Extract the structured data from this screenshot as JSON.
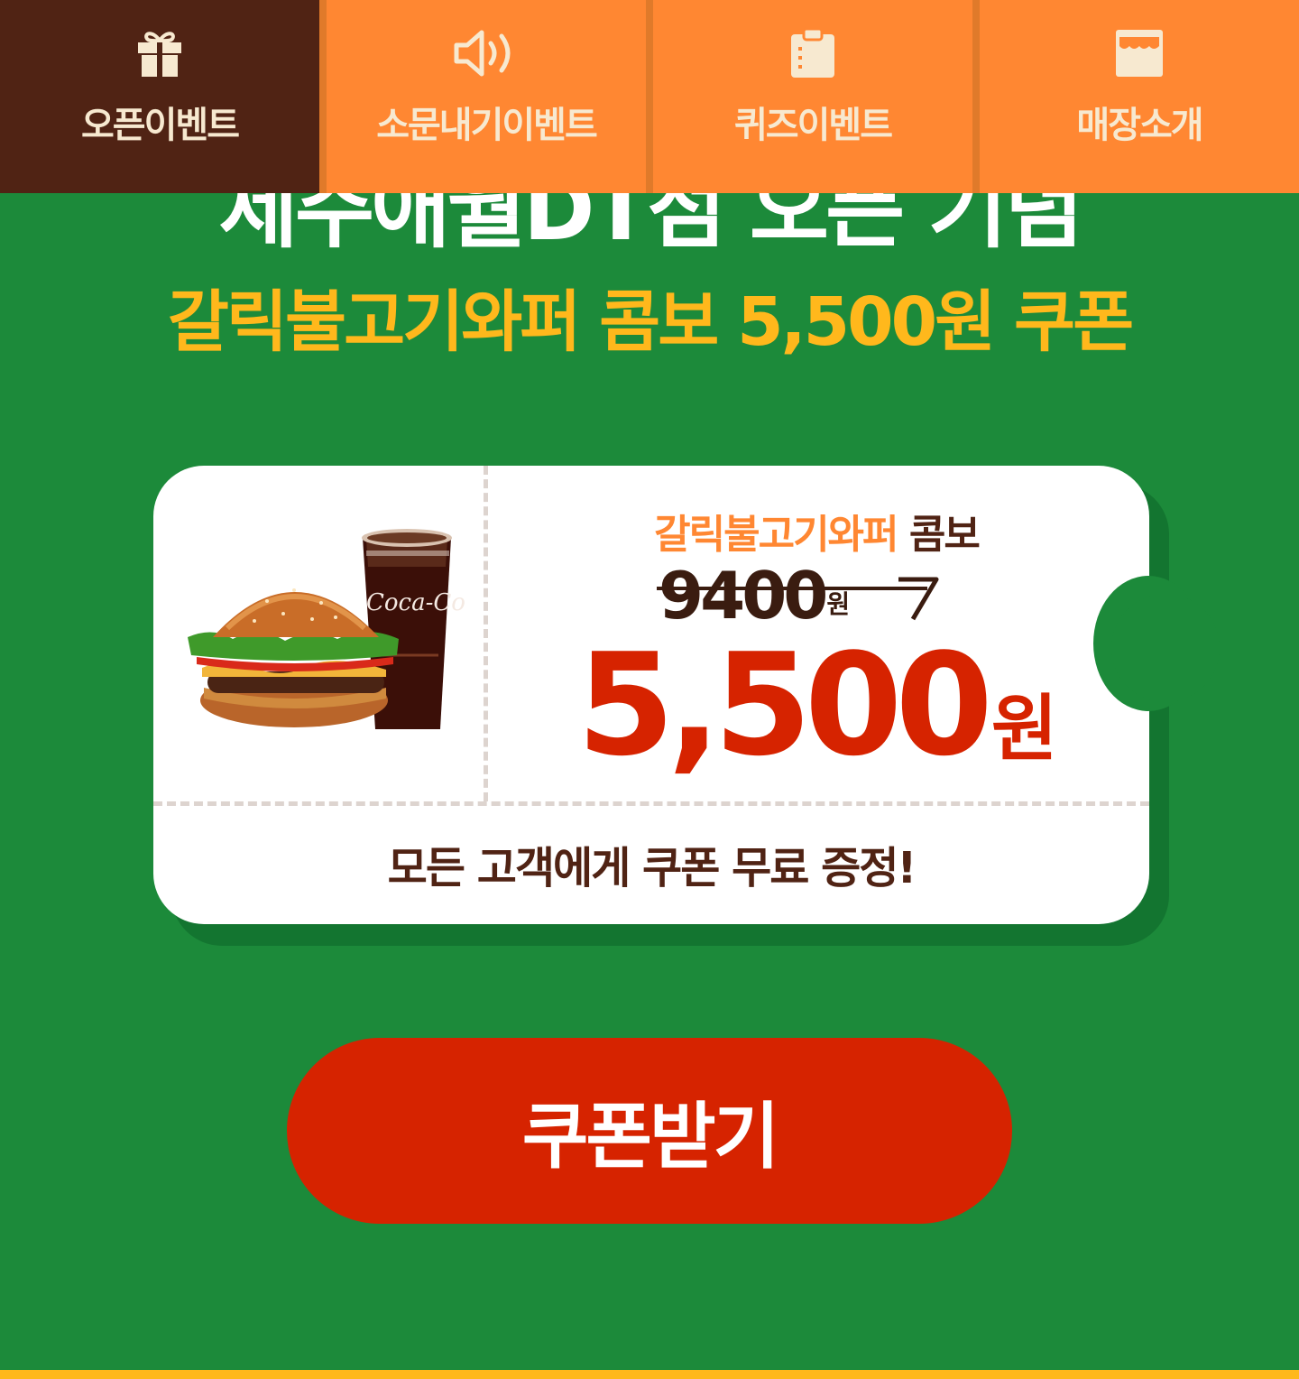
{
  "nav": {
    "tabs": [
      {
        "label": "오픈이벤트",
        "icon": "gift-icon",
        "active": true
      },
      {
        "label": "소문내기이벤트",
        "icon": "speaker-icon",
        "active": false
      },
      {
        "label": "퀴즈이벤트",
        "icon": "clipboard-icon",
        "active": false
      },
      {
        "label": "매장소개",
        "icon": "store-icon",
        "active": false
      }
    ]
  },
  "hero": {
    "title": "제주애월DT점 오픈 기념",
    "subtitle": "갈릭불고기와퍼 콤보 5,500원 쿠폰"
  },
  "coupon": {
    "menu_name": "갈릭불고기와퍼",
    "menu_kind": "콤보",
    "original_price": "9400",
    "original_unit": "원",
    "sale_price": "5,500",
    "sale_unit": "원",
    "product_image": "burger-and-cola-image",
    "cup_text": "Coca-Cola",
    "footer_text": "모든 고객에게 쿠폰 무료 증정!"
  },
  "cta": {
    "label": "쿠폰받기"
  },
  "colors": {
    "background": "#1c8a3a",
    "nav_orange": "#ff8732",
    "nav_active": "#502314",
    "accent_yellow": "#ffb81c",
    "sale_red": "#d62300"
  }
}
